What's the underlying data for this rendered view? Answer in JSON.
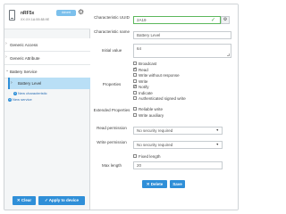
{
  "device": {
    "name": "nRF5x",
    "address": "XX:XX:1A:55:88:9E",
    "badge": "Advert",
    "settings_icon": "gear-icon",
    "icon": "phone-icon"
  },
  "sidebar": {
    "services": [
      {
        "label": "Generic Access"
      },
      {
        "label": "Generic Attribute"
      },
      {
        "label": "Battery Service"
      }
    ],
    "selected_characteristic": "Battery Level",
    "new_characteristic": "New characteristic",
    "new_service": "New service",
    "buttons": {
      "clear": "Clear",
      "apply": "Apply to device"
    }
  },
  "form": {
    "uuid_label": "Characteristic UUID",
    "uuid_value": "2A19",
    "uuid_button": "⚙",
    "name_label": "Characteristic name",
    "name_value": "Battery Level",
    "initial_label": "Initial value",
    "initial_value": "64",
    "properties_label": "Properties",
    "properties": [
      {
        "label": "Broadcast",
        "checked": false
      },
      {
        "label": "Read",
        "checked": true
      },
      {
        "label": "Write without response",
        "checked": false
      },
      {
        "label": "Write",
        "checked": false
      },
      {
        "label": "Notify",
        "checked": true
      },
      {
        "label": "Indicate",
        "checked": false
      },
      {
        "label": "Authenticated signed write",
        "checked": false
      }
    ],
    "extended_label": "Extended Properties",
    "extended": [
      {
        "label": "Reliable write",
        "checked": false
      },
      {
        "label": "Write auxiliary",
        "checked": false
      }
    ],
    "read_perm_label": "Read permission",
    "read_perm_value": "No security required",
    "write_perm_label": "Write permission",
    "write_perm_value": "No security required",
    "fixed_length_label": "Fixed length",
    "max_length_label": "Max length",
    "max_length_value": "20",
    "delete_label": "✕ Delete",
    "save_label": "Save"
  },
  "colors": {
    "accent": "#2f8fd8",
    "selected_row": "#b9dff6",
    "valid": "#5cb85c"
  }
}
